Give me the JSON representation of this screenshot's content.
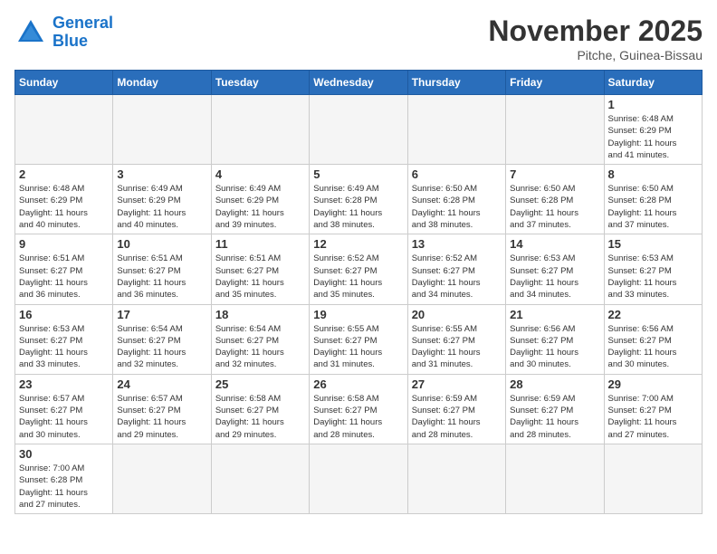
{
  "header": {
    "logo_general": "General",
    "logo_blue": "Blue",
    "month_title": "November 2025",
    "location": "Pitche, Guinea-Bissau"
  },
  "weekdays": [
    "Sunday",
    "Monday",
    "Tuesday",
    "Wednesday",
    "Thursday",
    "Friday",
    "Saturday"
  ],
  "weeks": [
    [
      {
        "day": "",
        "info": ""
      },
      {
        "day": "",
        "info": ""
      },
      {
        "day": "",
        "info": ""
      },
      {
        "day": "",
        "info": ""
      },
      {
        "day": "",
        "info": ""
      },
      {
        "day": "",
        "info": ""
      },
      {
        "day": "1",
        "info": "Sunrise: 6:48 AM\nSunset: 6:29 PM\nDaylight: 11 hours\nand 41 minutes."
      }
    ],
    [
      {
        "day": "2",
        "info": "Sunrise: 6:48 AM\nSunset: 6:29 PM\nDaylight: 11 hours\nand 40 minutes."
      },
      {
        "day": "3",
        "info": "Sunrise: 6:49 AM\nSunset: 6:29 PM\nDaylight: 11 hours\nand 40 minutes."
      },
      {
        "day": "4",
        "info": "Sunrise: 6:49 AM\nSunset: 6:29 PM\nDaylight: 11 hours\nand 39 minutes."
      },
      {
        "day": "5",
        "info": "Sunrise: 6:49 AM\nSunset: 6:28 PM\nDaylight: 11 hours\nand 38 minutes."
      },
      {
        "day": "6",
        "info": "Sunrise: 6:50 AM\nSunset: 6:28 PM\nDaylight: 11 hours\nand 38 minutes."
      },
      {
        "day": "7",
        "info": "Sunrise: 6:50 AM\nSunset: 6:28 PM\nDaylight: 11 hours\nand 37 minutes."
      },
      {
        "day": "8",
        "info": "Sunrise: 6:50 AM\nSunset: 6:28 PM\nDaylight: 11 hours\nand 37 minutes."
      }
    ],
    [
      {
        "day": "9",
        "info": "Sunrise: 6:51 AM\nSunset: 6:27 PM\nDaylight: 11 hours\nand 36 minutes."
      },
      {
        "day": "10",
        "info": "Sunrise: 6:51 AM\nSunset: 6:27 PM\nDaylight: 11 hours\nand 36 minutes."
      },
      {
        "day": "11",
        "info": "Sunrise: 6:51 AM\nSunset: 6:27 PM\nDaylight: 11 hours\nand 35 minutes."
      },
      {
        "day": "12",
        "info": "Sunrise: 6:52 AM\nSunset: 6:27 PM\nDaylight: 11 hours\nand 35 minutes."
      },
      {
        "day": "13",
        "info": "Sunrise: 6:52 AM\nSunset: 6:27 PM\nDaylight: 11 hours\nand 34 minutes."
      },
      {
        "day": "14",
        "info": "Sunrise: 6:53 AM\nSunset: 6:27 PM\nDaylight: 11 hours\nand 34 minutes."
      },
      {
        "day": "15",
        "info": "Sunrise: 6:53 AM\nSunset: 6:27 PM\nDaylight: 11 hours\nand 33 minutes."
      }
    ],
    [
      {
        "day": "16",
        "info": "Sunrise: 6:53 AM\nSunset: 6:27 PM\nDaylight: 11 hours\nand 33 minutes."
      },
      {
        "day": "17",
        "info": "Sunrise: 6:54 AM\nSunset: 6:27 PM\nDaylight: 11 hours\nand 32 minutes."
      },
      {
        "day": "18",
        "info": "Sunrise: 6:54 AM\nSunset: 6:27 PM\nDaylight: 11 hours\nand 32 minutes."
      },
      {
        "day": "19",
        "info": "Sunrise: 6:55 AM\nSunset: 6:27 PM\nDaylight: 11 hours\nand 31 minutes."
      },
      {
        "day": "20",
        "info": "Sunrise: 6:55 AM\nSunset: 6:27 PM\nDaylight: 11 hours\nand 31 minutes."
      },
      {
        "day": "21",
        "info": "Sunrise: 6:56 AM\nSunset: 6:27 PM\nDaylight: 11 hours\nand 30 minutes."
      },
      {
        "day": "22",
        "info": "Sunrise: 6:56 AM\nSunset: 6:27 PM\nDaylight: 11 hours\nand 30 minutes."
      }
    ],
    [
      {
        "day": "23",
        "info": "Sunrise: 6:57 AM\nSunset: 6:27 PM\nDaylight: 11 hours\nand 30 minutes."
      },
      {
        "day": "24",
        "info": "Sunrise: 6:57 AM\nSunset: 6:27 PM\nDaylight: 11 hours\nand 29 minutes."
      },
      {
        "day": "25",
        "info": "Sunrise: 6:58 AM\nSunset: 6:27 PM\nDaylight: 11 hours\nand 29 minutes."
      },
      {
        "day": "26",
        "info": "Sunrise: 6:58 AM\nSunset: 6:27 PM\nDaylight: 11 hours\nand 28 minutes."
      },
      {
        "day": "27",
        "info": "Sunrise: 6:59 AM\nSunset: 6:27 PM\nDaylight: 11 hours\nand 28 minutes."
      },
      {
        "day": "28",
        "info": "Sunrise: 6:59 AM\nSunset: 6:27 PM\nDaylight: 11 hours\nand 28 minutes."
      },
      {
        "day": "29",
        "info": "Sunrise: 7:00 AM\nSunset: 6:27 PM\nDaylight: 11 hours\nand 27 minutes."
      }
    ],
    [
      {
        "day": "30",
        "info": "Sunrise: 7:00 AM\nSunset: 6:28 PM\nDaylight: 11 hours\nand 27 minutes."
      },
      {
        "day": "",
        "info": ""
      },
      {
        "day": "",
        "info": ""
      },
      {
        "day": "",
        "info": ""
      },
      {
        "day": "",
        "info": ""
      },
      {
        "day": "",
        "info": ""
      },
      {
        "day": "",
        "info": ""
      }
    ]
  ]
}
